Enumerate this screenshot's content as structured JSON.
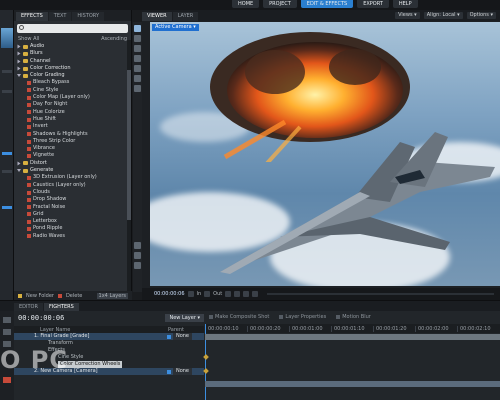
{
  "topbar": {
    "items": [
      "HOME",
      "PROJECT",
      "EDIT & EFFECTS",
      "EXPORT",
      "HELP"
    ],
    "active": "EDIT & EFFECTS"
  },
  "effects_panel": {
    "tabs": [
      "EFFECTS",
      "TEXT",
      "HISTORY"
    ],
    "search": {
      "value": "",
      "placeholder": ""
    },
    "filter": "Show All",
    "sort": "Ascending",
    "tree": [
      {
        "type": "folder",
        "label": "Audio"
      },
      {
        "type": "folder",
        "label": "Blurs"
      },
      {
        "type": "folder",
        "label": "Channel"
      },
      {
        "type": "folder",
        "label": "Color Correction"
      },
      {
        "type": "folder-open",
        "label": "Color Grading"
      },
      {
        "type": "item",
        "label": "Bleach Bypass"
      },
      {
        "type": "item",
        "label": "Cine Style"
      },
      {
        "type": "item",
        "label": "Color Map (Layer only)"
      },
      {
        "type": "item",
        "label": "Day For Night"
      },
      {
        "type": "item",
        "label": "Hue Colorize"
      },
      {
        "type": "item",
        "label": "Hue Shift"
      },
      {
        "type": "item",
        "label": "Invert"
      },
      {
        "type": "item",
        "label": "Shadows & Highlights"
      },
      {
        "type": "item",
        "label": "Three Strip Color"
      },
      {
        "type": "item",
        "label": "Vibrance"
      },
      {
        "type": "item",
        "label": "Vignette"
      },
      {
        "type": "folder",
        "label": "Distort"
      },
      {
        "type": "folder-open",
        "label": "Generate"
      },
      {
        "type": "item",
        "label": "3D Extrusion (Layer only)"
      },
      {
        "type": "item",
        "label": "Caustics (Layer only)"
      },
      {
        "type": "item",
        "label": "Clouds"
      },
      {
        "type": "item",
        "label": "Drop Shadow"
      },
      {
        "type": "item",
        "label": "Fractal Noise"
      },
      {
        "type": "item",
        "label": "Grid"
      },
      {
        "type": "item",
        "label": "Letterbox"
      },
      {
        "type": "item",
        "label": "Pond Ripple"
      },
      {
        "type": "item",
        "label": "Radio Waves"
      }
    ],
    "footer": {
      "new_folder": "New Folder",
      "delete": "Delete",
      "chip": "1x4 Layers"
    }
  },
  "viewer": {
    "tabs": [
      "VIEWER",
      "LAYER"
    ],
    "options": [
      "Views",
      "Align: Local",
      "Options"
    ],
    "camera": "Active Camera",
    "controls": {
      "time_in": "00:00:00:06",
      "in_label": "In",
      "out_label": "Out"
    }
  },
  "timeline": {
    "tabs": [
      "EDITOR",
      "FIGHTERS"
    ],
    "current_time": "00:00:00:06",
    "new_layer": "New Layer",
    "columns": {
      "layer_name": "Layer Name",
      "parent": "Parent"
    },
    "layers": [
      {
        "label": "1. Final Grade [Grade]",
        "parent": "None",
        "kind": "layer"
      },
      {
        "label": "Transform",
        "kind": "sub"
      },
      {
        "label": "Effects",
        "kind": "sub"
      },
      {
        "label": "Cine Style",
        "kind": "sub2"
      },
      {
        "label": "Color Correction Wheels",
        "kind": "sub2hl"
      },
      {
        "label": "2. New Camera [Camera]",
        "parent": "None",
        "kind": "layer"
      }
    ],
    "toolbar": [
      "Make Composite Shot",
      "Layer Properties",
      "Motion Blur"
    ],
    "ruler": [
      "00:00:00:10",
      "00:00:00:20",
      "00:00:01:00",
      "00:00:01:10",
      "00:00:01:20",
      "00:00:02:00",
      "00:00:02:10"
    ]
  },
  "watermark": "O PC"
}
